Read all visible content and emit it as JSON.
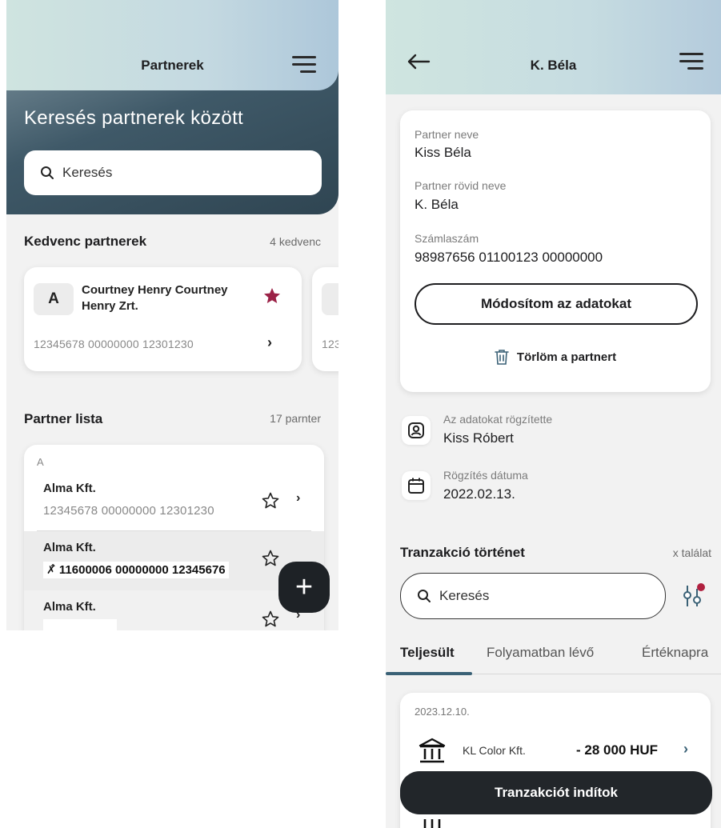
{
  "left_screen": {
    "header_title": "Partnerek",
    "hero_title": "Keresés partnerek között",
    "search": {
      "placeholder": "Keresés"
    },
    "favorites": {
      "title": "Kedvenc partnerek",
      "count_label": "4 kedvenc",
      "cards": [
        {
          "initial": "A",
          "name_line1": "Courtney Henry Courtney",
          "name_line2": "Henry Zrt.",
          "account": "12345678 00000000 12301230",
          "favorite": true
        }
      ],
      "peek_card_account": "123"
    },
    "list": {
      "title": "Partner lista",
      "count_label": "17 parnter",
      "group_letter": "A",
      "rows": [
        {
          "name": "Alma Kft.",
          "account": "12345678 00000000 12301230"
        },
        {
          "name": "Alma Kft.",
          "account": "11600006 00000000 12345676"
        },
        {
          "name": "Alma Kft.",
          "account": ""
        }
      ]
    },
    "fab_label": "+"
  },
  "right_screen": {
    "header_title": "K. Béla",
    "details": {
      "partner_name_label": "Partner neve",
      "partner_name_value": "Kiss Béla",
      "short_name_label": "Partner rövid neve",
      "short_name_value": "K. Béla",
      "account_label": "Számlaszám",
      "account_value": "98987656 01100123 00000000",
      "edit_button": "Módosítom az adatokat",
      "delete_button": "Törlöm a partnert"
    },
    "recorded_by_label": "Az adatokat rögzítette",
    "recorded_by_value": "Kiss Róbert",
    "record_date_label": "Rögzítés dátuma",
    "record_date_value": "2022.02.13.",
    "transactions": {
      "title": "Tranzakció történet",
      "count_label": "x találat",
      "search_placeholder": "Keresés",
      "tabs": [
        "Teljesült",
        "Folyamatban lévő",
        "Értéknapra"
      ],
      "date": "2023.12.10.",
      "items": [
        {
          "name": "KL Color Kft.",
          "amount": "- 28 000 HUF"
        }
      ]
    },
    "start_button": "Tranzakciót indítok"
  },
  "colors": {
    "accent_dark": "#22262a",
    "favorite_star": "#9b2247",
    "filter_dot": "#b0203f",
    "tab_underline": "#3a6176"
  }
}
